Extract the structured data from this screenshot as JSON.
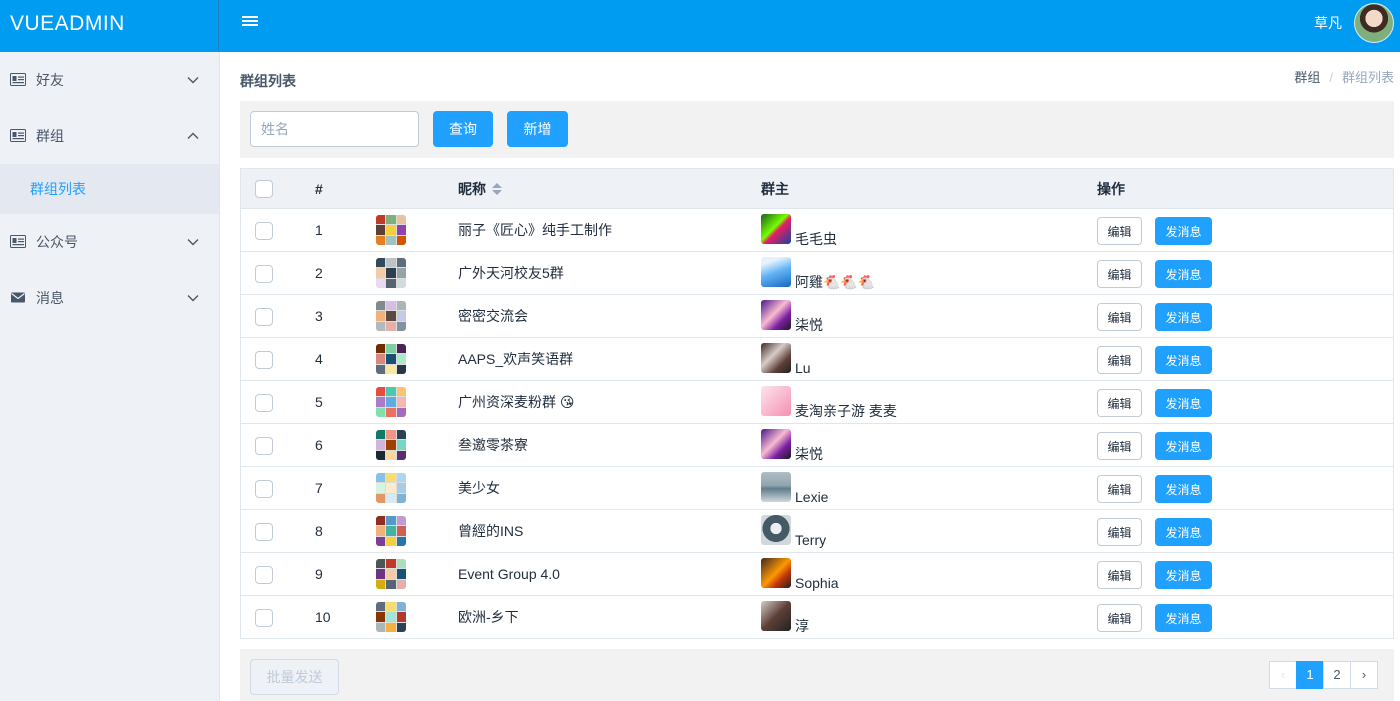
{
  "header": {
    "brand": "VUEADMIN",
    "username": "草凡"
  },
  "sidebar": {
    "items": [
      {
        "label": "好友",
        "icon": "id-card-icon",
        "expanded": false
      },
      {
        "label": "群组",
        "icon": "id-card-icon",
        "expanded": true,
        "children": [
          {
            "label": "群组列表",
            "active": true
          }
        ]
      },
      {
        "label": "公众号",
        "icon": "id-card-icon",
        "expanded": false
      },
      {
        "label": "消息",
        "icon": "envelope-icon",
        "expanded": false
      }
    ]
  },
  "page": {
    "title": "群组列表",
    "breadcrumb": [
      "群组",
      "群组列表"
    ],
    "breadcrumb_sep": "/"
  },
  "toolbar": {
    "search_placeholder": "姓名",
    "search_value": "",
    "query_label": "查询",
    "add_label": "新增"
  },
  "table": {
    "headers": {
      "index": "#",
      "nickname": "昵称",
      "owner": "群主",
      "actions": "操作"
    },
    "edit_label": "编辑",
    "send_label": "发消息",
    "rows": [
      {
        "index": "1",
        "name": "丽子《匠心》纯手工制作",
        "owner": "毛毛虫"
      },
      {
        "index": "2",
        "name": "广外天河校友5群",
        "owner": "阿雞🐔🐔🐔"
      },
      {
        "index": "3",
        "name": "密密交流会",
        "owner": "柒悦"
      },
      {
        "index": "4",
        "name": "AAPS_欢声笑语群",
        "owner": "Lu"
      },
      {
        "index": "5",
        "name": "广州资深麦粉群 😘",
        "owner": "麦淘亲子游 麦麦"
      },
      {
        "index": "6",
        "name": "叁邀零茶寮",
        "owner": "柒悦"
      },
      {
        "index": "7",
        "name": "美少女",
        "owner": "Lexie"
      },
      {
        "index": "8",
        "name": "曾經的INS",
        "owner": "Terry"
      },
      {
        "index": "9",
        "name": "Event Group 4.0",
        "owner": "Sophia"
      },
      {
        "index": "10",
        "name": "欧洲-乡下",
        "owner": "淳"
      }
    ]
  },
  "footer": {
    "batch_send_label": "批量发送",
    "pages": [
      "1",
      "2"
    ],
    "current_page": "1",
    "prev_symbol": "‹",
    "next_symbol": "›"
  },
  "colors": {
    "header_bg": "#009cf2",
    "primary": "#20a0ff",
    "sidebar_bg": "#eef1f6"
  }
}
